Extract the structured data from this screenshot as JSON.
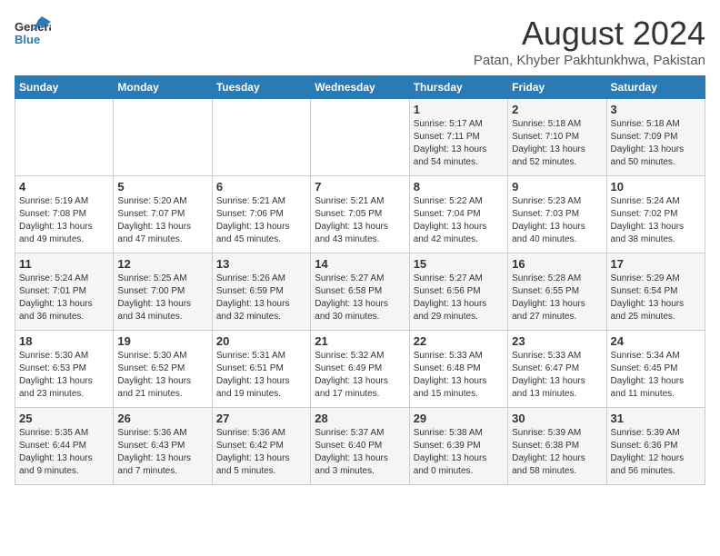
{
  "header": {
    "logo_general": "General",
    "logo_blue": "Blue",
    "title": "August 2024",
    "subtitle": "Patan, Khyber Pakhtunkhwa, Pakistan"
  },
  "days_of_week": [
    "Sunday",
    "Monday",
    "Tuesday",
    "Wednesday",
    "Thursday",
    "Friday",
    "Saturday"
  ],
  "weeks": [
    [
      {
        "day": "",
        "text": ""
      },
      {
        "day": "",
        "text": ""
      },
      {
        "day": "",
        "text": ""
      },
      {
        "day": "",
        "text": ""
      },
      {
        "day": "1",
        "text": "Sunrise: 5:17 AM\nSunset: 7:11 PM\nDaylight: 13 hours\nand 54 minutes."
      },
      {
        "day": "2",
        "text": "Sunrise: 5:18 AM\nSunset: 7:10 PM\nDaylight: 13 hours\nand 52 minutes."
      },
      {
        "day": "3",
        "text": "Sunrise: 5:18 AM\nSunset: 7:09 PM\nDaylight: 13 hours\nand 50 minutes."
      }
    ],
    [
      {
        "day": "4",
        "text": "Sunrise: 5:19 AM\nSunset: 7:08 PM\nDaylight: 13 hours\nand 49 minutes."
      },
      {
        "day": "5",
        "text": "Sunrise: 5:20 AM\nSunset: 7:07 PM\nDaylight: 13 hours\nand 47 minutes."
      },
      {
        "day": "6",
        "text": "Sunrise: 5:21 AM\nSunset: 7:06 PM\nDaylight: 13 hours\nand 45 minutes."
      },
      {
        "day": "7",
        "text": "Sunrise: 5:21 AM\nSunset: 7:05 PM\nDaylight: 13 hours\nand 43 minutes."
      },
      {
        "day": "8",
        "text": "Sunrise: 5:22 AM\nSunset: 7:04 PM\nDaylight: 13 hours\nand 42 minutes."
      },
      {
        "day": "9",
        "text": "Sunrise: 5:23 AM\nSunset: 7:03 PM\nDaylight: 13 hours\nand 40 minutes."
      },
      {
        "day": "10",
        "text": "Sunrise: 5:24 AM\nSunset: 7:02 PM\nDaylight: 13 hours\nand 38 minutes."
      }
    ],
    [
      {
        "day": "11",
        "text": "Sunrise: 5:24 AM\nSunset: 7:01 PM\nDaylight: 13 hours\nand 36 minutes."
      },
      {
        "day": "12",
        "text": "Sunrise: 5:25 AM\nSunset: 7:00 PM\nDaylight: 13 hours\nand 34 minutes."
      },
      {
        "day": "13",
        "text": "Sunrise: 5:26 AM\nSunset: 6:59 PM\nDaylight: 13 hours\nand 32 minutes."
      },
      {
        "day": "14",
        "text": "Sunrise: 5:27 AM\nSunset: 6:58 PM\nDaylight: 13 hours\nand 30 minutes."
      },
      {
        "day": "15",
        "text": "Sunrise: 5:27 AM\nSunset: 6:56 PM\nDaylight: 13 hours\nand 29 minutes."
      },
      {
        "day": "16",
        "text": "Sunrise: 5:28 AM\nSunset: 6:55 PM\nDaylight: 13 hours\nand 27 minutes."
      },
      {
        "day": "17",
        "text": "Sunrise: 5:29 AM\nSunset: 6:54 PM\nDaylight: 13 hours\nand 25 minutes."
      }
    ],
    [
      {
        "day": "18",
        "text": "Sunrise: 5:30 AM\nSunset: 6:53 PM\nDaylight: 13 hours\nand 23 minutes."
      },
      {
        "day": "19",
        "text": "Sunrise: 5:30 AM\nSunset: 6:52 PM\nDaylight: 13 hours\nand 21 minutes."
      },
      {
        "day": "20",
        "text": "Sunrise: 5:31 AM\nSunset: 6:51 PM\nDaylight: 13 hours\nand 19 minutes."
      },
      {
        "day": "21",
        "text": "Sunrise: 5:32 AM\nSunset: 6:49 PM\nDaylight: 13 hours\nand 17 minutes."
      },
      {
        "day": "22",
        "text": "Sunrise: 5:33 AM\nSunset: 6:48 PM\nDaylight: 13 hours\nand 15 minutes."
      },
      {
        "day": "23",
        "text": "Sunrise: 5:33 AM\nSunset: 6:47 PM\nDaylight: 13 hours\nand 13 minutes."
      },
      {
        "day": "24",
        "text": "Sunrise: 5:34 AM\nSunset: 6:45 PM\nDaylight: 13 hours\nand 11 minutes."
      }
    ],
    [
      {
        "day": "25",
        "text": "Sunrise: 5:35 AM\nSunset: 6:44 PM\nDaylight: 13 hours\nand 9 minutes."
      },
      {
        "day": "26",
        "text": "Sunrise: 5:36 AM\nSunset: 6:43 PM\nDaylight: 13 hours\nand 7 minutes."
      },
      {
        "day": "27",
        "text": "Sunrise: 5:36 AM\nSunset: 6:42 PM\nDaylight: 13 hours\nand 5 minutes."
      },
      {
        "day": "28",
        "text": "Sunrise: 5:37 AM\nSunset: 6:40 PM\nDaylight: 13 hours\nand 3 minutes."
      },
      {
        "day": "29",
        "text": "Sunrise: 5:38 AM\nSunset: 6:39 PM\nDaylight: 13 hours\nand 0 minutes."
      },
      {
        "day": "30",
        "text": "Sunrise: 5:39 AM\nSunset: 6:38 PM\nDaylight: 12 hours\nand 58 minutes."
      },
      {
        "day": "31",
        "text": "Sunrise: 5:39 AM\nSunset: 6:36 PM\nDaylight: 12 hours\nand 56 minutes."
      }
    ]
  ]
}
